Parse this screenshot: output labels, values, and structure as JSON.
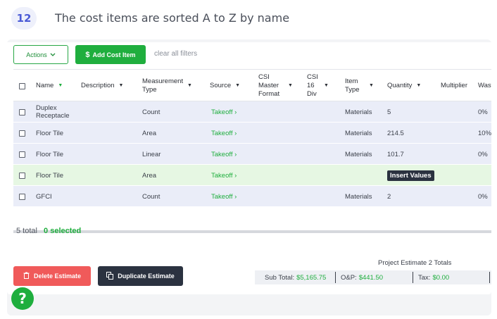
{
  "step": {
    "number": "12",
    "text": "The cost items are sorted A to Z by name"
  },
  "toolbar": {
    "actions_label": "Actions",
    "add_label": "Add Cost Item",
    "clear_label": "clear all filters"
  },
  "table": {
    "headers": {
      "name": "Name",
      "description": "Description",
      "measurement": "Measurement Type",
      "source": "Source",
      "csi_master": "CSI Master Format",
      "csi_16": "CSI 16 Div",
      "item_type": "Item Type",
      "quantity": "Quantity",
      "multiplier": "Multiplier",
      "waste": "Wast"
    },
    "rows": [
      {
        "name": "Duplex Receptacle",
        "measurement": "Count",
        "source": "Takeoff",
        "item_type": "Materials",
        "quantity": "5",
        "waste": "0%"
      },
      {
        "name": "Floor Tile",
        "measurement": "Area",
        "source": "Takeoff",
        "item_type": "Materials",
        "quantity": "214.5",
        "waste": "10%"
      },
      {
        "name": "Floor Tile",
        "measurement": "Linear",
        "source": "Takeoff",
        "item_type": "Materials",
        "quantity": "101.7",
        "waste": "0%"
      },
      {
        "name": "Floor Tile",
        "measurement": "Area",
        "source": "Takeoff",
        "item_type": "",
        "quantity": "Insert Values",
        "waste": ""
      },
      {
        "name": "GFCI",
        "measurement": "Count",
        "source": "Takeoff",
        "item_type": "Materials",
        "quantity": "2",
        "waste": "0%"
      }
    ]
  },
  "summary": {
    "total": "5 total",
    "selected": "0 selected"
  },
  "actions": {
    "delete_label": "Delete Estimate",
    "duplicate_label": "Duplicate Estimate"
  },
  "totals": {
    "title": "Project Estimate 2 Totals",
    "subtotal_label": "Sub Total:",
    "subtotal_value": "$5,165.75",
    "op_label": "O&P:",
    "op_value": "$441.50",
    "tax_label": "Tax:",
    "tax_value": "$0.00"
  },
  "help_label": "?",
  "colors": {
    "accent_green": "#1fae3e",
    "danger": "#f05a5a",
    "dark": "#2b3240",
    "row_blue": "#eaedf8",
    "row_green": "#e6f7e3"
  }
}
